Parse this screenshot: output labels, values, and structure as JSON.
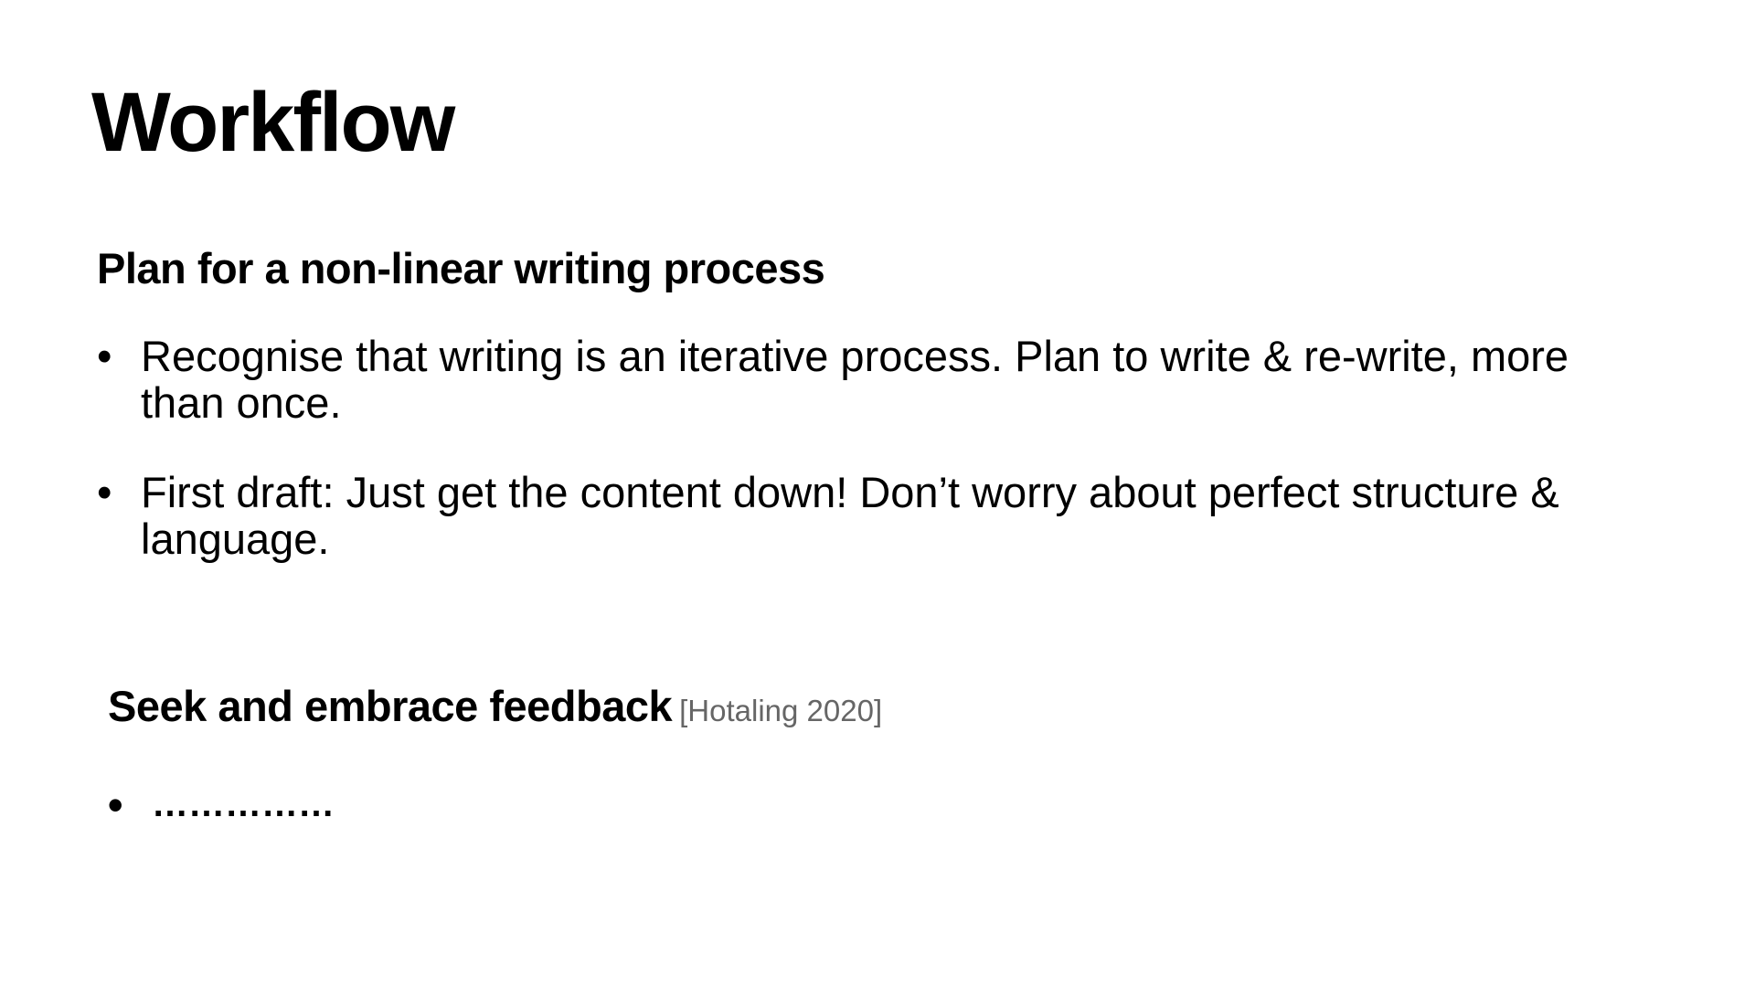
{
  "slide": {
    "title": "Workflow",
    "sections": [
      {
        "heading": "Plan for a non-linear writing process",
        "bullets": [
          "Recognise that writing is an iterative process. Plan to write & re-write, more than once.",
          "First draft: Just get the content down! Don’t worry about perfect structure & language."
        ]
      },
      {
        "heading": "Seek and embrace feedback",
        "citation": "[Hotaling 2020]",
        "bullets": [
          "……………"
        ]
      }
    ],
    "bullet_glyph": "•"
  }
}
